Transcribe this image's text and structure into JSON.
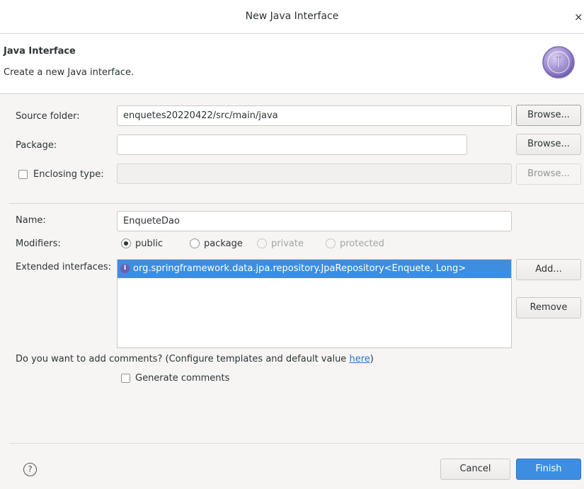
{
  "window": {
    "title": "New Java Interface",
    "close_glyph": "×"
  },
  "header": {
    "heading": "Java Interface",
    "description": "Create a new Java interface.",
    "banner_letter": "I",
    "banner_icon": "interface-wizard-banner-icon"
  },
  "form": {
    "source_folder": {
      "label": "Source folder:",
      "value": "enquetes20220422/src/main/java",
      "browse": "Browse..."
    },
    "package": {
      "label": "Package:",
      "value": "",
      "browse": "Browse..."
    },
    "enclosing_type": {
      "label": "Enclosing type:",
      "checked": false,
      "value": "",
      "browse": "Browse..."
    },
    "name": {
      "label": "Name:",
      "value": "EnqueteDao"
    },
    "modifiers": {
      "label": "Modifiers:",
      "options": [
        {
          "label": "public",
          "selected": true,
          "enabled": true
        },
        {
          "label": "package",
          "selected": false,
          "enabled": true
        },
        {
          "label": "private",
          "selected": false,
          "enabled": false
        },
        {
          "label": "protected",
          "selected": false,
          "enabled": false
        }
      ]
    },
    "extended_interfaces": {
      "label": "Extended interfaces:",
      "items": [
        "org.springframework.data.jpa.repository.JpaRepository<Enquete, Long>"
      ],
      "icon_letter": "I",
      "add": "Add...",
      "remove": "Remove"
    },
    "comments": {
      "question_before": "Do you want to add comments? (Configure templates and default value ",
      "link": "here",
      "question_after": ")",
      "generate_label": "Generate comments",
      "generate_checked": false
    }
  },
  "footer": {
    "help_glyph": "?",
    "cancel": "Cancel",
    "finish": "Finish"
  },
  "colors": {
    "accent": "#3d8ee0",
    "link": "#2a76c6",
    "banner": "#8a78c0"
  }
}
